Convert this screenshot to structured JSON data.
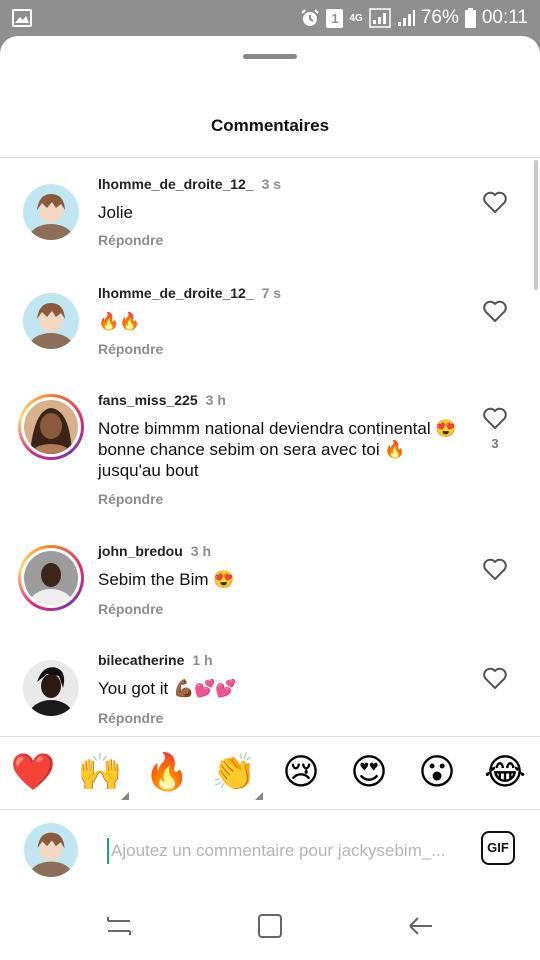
{
  "status_bar": {
    "battery": "76%",
    "time": "00:11",
    "network": "4G",
    "icons": [
      "gallery-icon",
      "alarm-icon",
      "sim1-badge-icon",
      "network-4g-icon",
      "signal-icon",
      "signal-icon",
      "battery-icon"
    ],
    "sim_badge": "1"
  },
  "sheet": {
    "title": "Commentaires"
  },
  "comments": [
    {
      "username": "lhomme_de_droite_12_",
      "time": "3 s",
      "text": "Jolie",
      "reply": "Répondre",
      "likes": ""
    },
    {
      "username": "lhomme_de_droite_12_",
      "time": "7 s",
      "text": "🔥🔥",
      "reply": "Répondre",
      "likes": ""
    },
    {
      "username": "fans_miss_225",
      "time": "3 h",
      "text": "Notre bimmm national deviendra continental 😍 bonne chance sebim on sera avec toi 🔥 jusqu'au bout",
      "reply": "Répondre",
      "likes": "3"
    },
    {
      "username": "john_bredou",
      "time": "3 h",
      "text": "Sebim the Bim 😍",
      "reply": "Répondre",
      "likes": ""
    },
    {
      "username": "bilecatherine",
      "time": "1 h",
      "text": "You got it 💪🏾💕💕",
      "reply": "Répondre",
      "likes": ""
    }
  ],
  "emoji_bar": [
    "❤️",
    "🙌",
    "🔥",
    "👏",
    "😢",
    "😍",
    "😮",
    "😂"
  ],
  "composer": {
    "placeholder": "Ajoutez un commentaire pour jackysebim_...",
    "value": "",
    "gif_label": "GIF"
  },
  "nav": {
    "icons": [
      "recent-apps-icon",
      "home-icon",
      "back-icon"
    ]
  },
  "colors": {
    "accent_ring_start": "#f58529",
    "accent_ring_end": "#dd2a7b",
    "muted_text": "#8e8e8e",
    "status_bar_bg": "#8f8f8f"
  }
}
